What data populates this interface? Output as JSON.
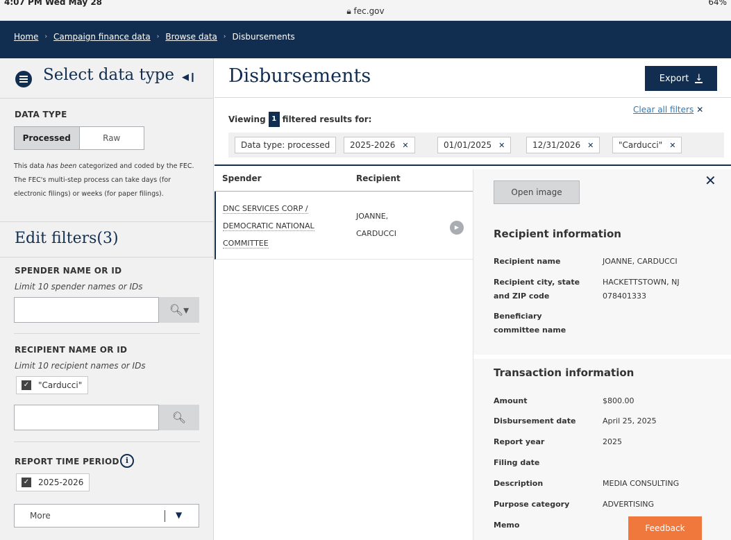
{
  "status_bar": {
    "time": "4:07 PM  Wed May 28",
    "url": "fec.gov",
    "battery": "64%"
  },
  "breadcrumbs": [
    "Home",
    "Campaign finance data",
    "Browse data",
    "Disbursements"
  ],
  "sidebar": {
    "select_title": "Select data type",
    "data_type_label": "DATA TYPE",
    "toggle": {
      "processed": "Processed",
      "raw": "Raw"
    },
    "data_type_desc_a": "This data ",
    "data_type_desc_em": "has been",
    "data_type_desc_b": " categorized and coded by the FEC. The FEC's multi-step process can take days (for electronic filings) or weeks (for paper filings).",
    "edit_title": "Edit filters(3)",
    "spender": {
      "label": "SPENDER NAME OR ID",
      "hint": "Limit 10 spender names or IDs"
    },
    "recipient": {
      "label": "RECIPIENT NAME OR ID",
      "hint": "Limit 10 recipient names or IDs",
      "checked": "\"Carducci\""
    },
    "period": {
      "label": "REPORT TIME PERIOD",
      "checked": "2025-2026",
      "more": "More"
    }
  },
  "main": {
    "title": "Disbursements",
    "export": "Export",
    "viewing_pre": "Viewing",
    "viewing_count": "1",
    "viewing_post": "filtered results for:",
    "clear_all": "Clear all filters",
    "tags": [
      "Data type: processed",
      "2025-2026",
      "01/01/2025",
      "12/31/2026",
      "\"Carducci\""
    ],
    "table": {
      "headers": [
        "Spender",
        "Recipient"
      ],
      "spender_lines": [
        "DNC SERVICES CORP /",
        "DEMOCRATIC NATIONAL",
        "COMMITTEE"
      ],
      "recipient_lines": [
        "JOANNE,",
        "CARDUCCI"
      ]
    }
  },
  "panel": {
    "open_image": "Open image",
    "recipient_section": "Recipient information",
    "recipient_fields": [
      {
        "label": "Recipient name",
        "value": "JOANNE, CARDUCCI"
      },
      {
        "label": "Recipient city, state and ZIP code",
        "value": "HACKETTSTOWN, NJ 078401333"
      },
      {
        "label": "Beneficiary committee name",
        "value": ""
      }
    ],
    "transaction_section": "Transaction information",
    "transaction_fields": [
      {
        "label": "Amount",
        "value": "$800.00"
      },
      {
        "label": "Disbursement date",
        "value": "April 25, 2025"
      },
      {
        "label": "Report year",
        "value": "2025"
      },
      {
        "label": "Filing date",
        "value": ""
      },
      {
        "label": "Description",
        "value": "MEDIA CONSULTING"
      },
      {
        "label": "Purpose category",
        "value": "ADVERTISING"
      },
      {
        "label": "Memo",
        "value": ""
      }
    ]
  },
  "feedback": "Feedback"
}
